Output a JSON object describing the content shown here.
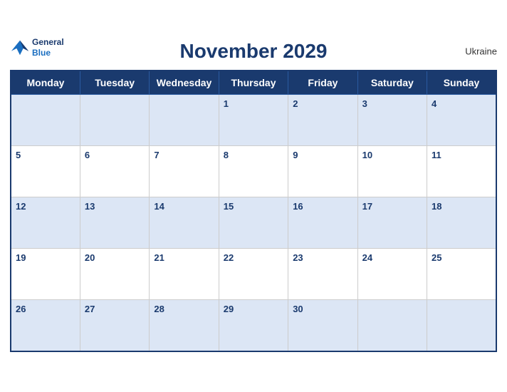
{
  "header": {
    "title": "November 2029",
    "country": "Ukraine",
    "logo": {
      "general": "General",
      "blue": "Blue"
    }
  },
  "weekdays": [
    "Monday",
    "Tuesday",
    "Wednesday",
    "Thursday",
    "Friday",
    "Saturday",
    "Sunday"
  ],
  "weeks": [
    [
      null,
      null,
      null,
      1,
      2,
      3,
      4
    ],
    [
      5,
      6,
      7,
      8,
      9,
      10,
      11
    ],
    [
      12,
      13,
      14,
      15,
      16,
      17,
      18
    ],
    [
      19,
      20,
      21,
      22,
      23,
      24,
      25
    ],
    [
      26,
      27,
      28,
      29,
      30,
      null,
      null
    ]
  ]
}
